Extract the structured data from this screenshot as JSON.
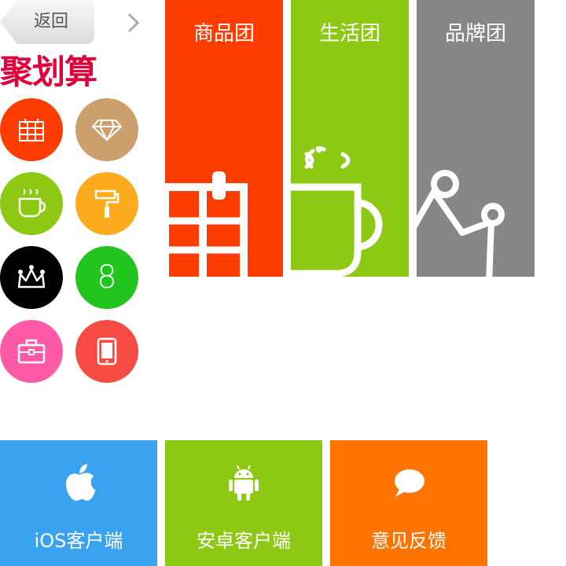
{
  "header": {
    "back_label": "返回",
    "brand_title": "聚划算"
  },
  "categories": [
    {
      "icon": "calendar-icon",
      "color": "#ff3d00"
    },
    {
      "icon": "diamond-icon",
      "color": "#cba06c"
    },
    {
      "icon": "coffee-cup-icon",
      "color": "#8cc814"
    },
    {
      "icon": "paint-roller-icon",
      "color": "#ffab1e"
    },
    {
      "icon": "crown-icon",
      "color": "#000000"
    },
    {
      "icon": "number-eight-icon",
      "color": "#22c41e",
      "text": "8"
    },
    {
      "icon": "briefcase-icon",
      "color": "#ff5aa8"
    },
    {
      "icon": "tablet-icon",
      "color": "#f74c44"
    }
  ],
  "panels": [
    {
      "label": "商品团",
      "color": "#ff3d00",
      "icon": "calendar-icon"
    },
    {
      "label": "生活团",
      "color": "#8cc814",
      "icon": "coffee-cup-icon"
    },
    {
      "label": "品牌团",
      "color": "#878787",
      "icon": "crown-icon"
    }
  ],
  "tiles": [
    {
      "label": "iOS客户端",
      "color": "#3aa3f0",
      "icon": "apple-icon"
    },
    {
      "label": "安卓客户端",
      "color": "#8cc814",
      "icon": "android-icon"
    },
    {
      "label": "意见反馈",
      "color": "#ff7300",
      "icon": "speech-bubble-icon"
    }
  ]
}
